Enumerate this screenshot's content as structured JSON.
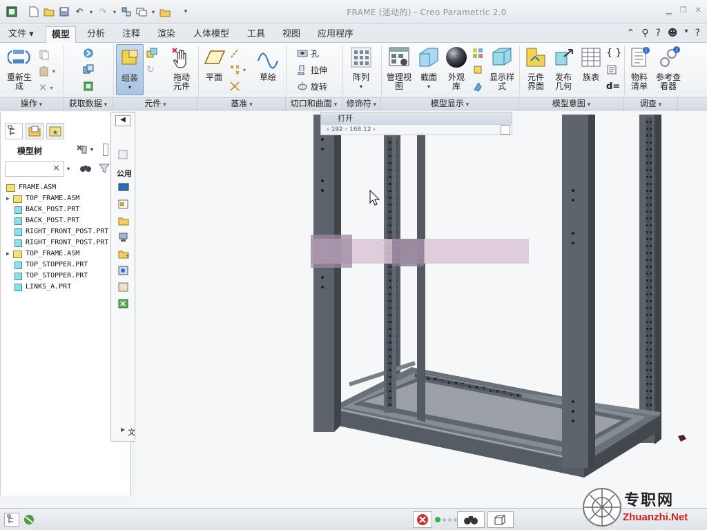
{
  "window": {
    "title": "FRAME (活动的) - Creo Parametric 2.0"
  },
  "tabs": [
    "文件 ▾",
    "模型",
    "分析",
    "注释",
    "渲染",
    "人体模型",
    "工具",
    "视图",
    "应用程序"
  ],
  "ribbon": {
    "regen": "重新生成",
    "assemble": "组装",
    "drag": "拖动元件",
    "plane": "平面",
    "sketch": "草绘",
    "hole": "孔",
    "extrude": "拉伸",
    "revolve": "旋转",
    "pattern": "阵列",
    "manage_views": "管理视图",
    "section": "截面",
    "appearance": "外观库",
    "display_style": "显示样式",
    "comp_interface": "元件界面",
    "publish_geom": "发布几何",
    "family_table": "族表",
    "bom": "物料清单",
    "ref_viewer": "参考查看器"
  },
  "groups": [
    "操作",
    "获取数据",
    "元件",
    "基准",
    "切口和曲面",
    "修饰符",
    "模型显示",
    "模型意图",
    "调查"
  ],
  "model_tree": {
    "label": "模型树",
    "items": [
      {
        "name": "FRAME.ASM",
        "type": "asm",
        "level": 0,
        "expand": false
      },
      {
        "name": "TOP_FRAME.ASM",
        "type": "asm",
        "level": 1,
        "expand": true
      },
      {
        "name": "BACK_POST.PRT",
        "type": "prt",
        "level": 1,
        "expand": false
      },
      {
        "name": "BACK_POST.PRT",
        "type": "prt",
        "level": 1,
        "expand": false
      },
      {
        "name": "RIGHT_FRONT_POST.PRT",
        "type": "prt",
        "level": 1,
        "expand": false
      },
      {
        "name": "RIGHT_FRONT_POST.PRT",
        "type": "prt",
        "level": 1,
        "expand": false
      },
      {
        "name": "TOP_FRAME.ASM",
        "type": "asm",
        "level": 1,
        "expand": true
      },
      {
        "name": "TOP_STOPPER.PRT",
        "type": "prt",
        "level": 1,
        "expand": false
      },
      {
        "name": "TOP_STOPPER.PRT",
        "type": "prt",
        "level": 1,
        "expand": false
      },
      {
        "name": "LINKS_A.PRT",
        "type": "prt",
        "level": 1,
        "expand": false
      }
    ]
  },
  "browser": {
    "common_label": "公用",
    "bottom_label": "文"
  },
  "open_dialog": {
    "title": "打开",
    "crumb": "› 192 › 168.12 ›"
  },
  "watermark": {
    "cn": "专职网",
    "en": "Zhuanzhi.Net"
  },
  "colors": {
    "frame": "#5a6068",
    "frame_light": "#8a9097",
    "frame_dark": "#3a3f45",
    "accent": "#2d6fc4"
  }
}
